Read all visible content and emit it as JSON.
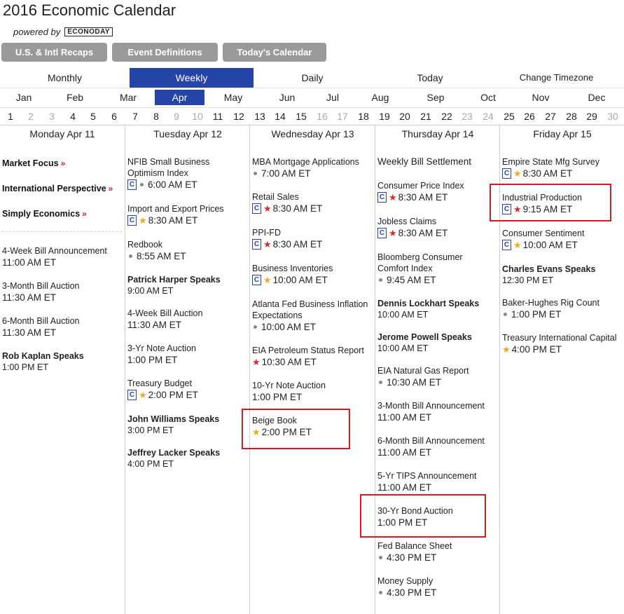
{
  "header": {
    "title": "2016 Economic Calendar",
    "powered_by": "powered by",
    "brand": "ECONODAY"
  },
  "buttons": [
    "U.S. & Intl Recaps",
    "Event Definitions",
    "Today's Calendar"
  ],
  "views": [
    "Monthly",
    "Weekly",
    "Daily",
    "Today",
    "Change Timezone"
  ],
  "active_view": "Weekly",
  "months": [
    "Jan",
    "Feb",
    "Mar",
    "Apr",
    "May",
    "Jun",
    "Jul",
    "Aug",
    "Sep",
    "Oct",
    "Nov",
    "Dec"
  ],
  "active_month": "Apr",
  "days": [
    "1",
    "2",
    "3",
    "4",
    "5",
    "6",
    "7",
    "8",
    "9",
    "10",
    "11",
    "12",
    "13",
    "14",
    "15",
    "16",
    "17",
    "18",
    "19",
    "20",
    "21",
    "22",
    "23",
    "24",
    "25",
    "26",
    "27",
    "28",
    "29",
    "30"
  ],
  "muted_days": [
    "2",
    "3",
    "9",
    "10",
    "16",
    "17",
    "23",
    "24",
    "30"
  ],
  "columns": {
    "mon": {
      "header": "Monday Apr 11",
      "links": [
        "Market Focus",
        "International Perspective",
        "Simply Economics"
      ],
      "events": [
        {
          "name": "4-Week Bill Announcement",
          "time": "11:00 AM ET",
          "bold": false
        },
        {
          "name": "3-Month Bill Auction",
          "time": "11:30 AM ET",
          "bold": false
        },
        {
          "name": "6-Month Bill Auction",
          "time": "11:30 AM ET",
          "bold": false
        },
        {
          "name": "Rob Kaplan Speaks",
          "time": "1:00 PM ET",
          "bold": true
        }
      ]
    },
    "tue": {
      "header": "Tuesday Apr 12",
      "events": [
        {
          "name": "NFIB Small Business Optimism Index",
          "time": "6:00 AM ET"
        },
        {
          "name": "Import and Export Prices",
          "time": "8:30 AM ET"
        },
        {
          "name": "Redbook",
          "time": "8:55 AM ET"
        },
        {
          "name": "Patrick Harper Speaks",
          "time": "9:00 AM ET"
        },
        {
          "name": "4-Week Bill Auction",
          "time": "11:30 AM ET"
        },
        {
          "name": "3-Yr Note Auction",
          "time": "1:00 PM ET"
        },
        {
          "name": "Treasury Budget",
          "time": "2:00 PM ET"
        },
        {
          "name": "John Williams Speaks",
          "time": "3:00 PM ET"
        },
        {
          "name": "Jeffrey Lacker Speaks",
          "time": "4:00 PM ET"
        }
      ]
    },
    "wed": {
      "header": "Wednesday Apr 13",
      "events": [
        {
          "name": "MBA Mortgage Applications",
          "time": "7:00 AM ET"
        },
        {
          "name": "Retail Sales",
          "time": "8:30 AM ET"
        },
        {
          "name": "PPI-FD",
          "time": "8:30 AM ET"
        },
        {
          "name": "Business Inventories",
          "time": "10:00 AM ET"
        },
        {
          "name": "Atlanta Fed Business Inflation Expectations",
          "time": "10:00 AM ET"
        },
        {
          "name": "EIA Petroleum Status Report",
          "time": "10:30 AM ET"
        },
        {
          "name": "10-Yr Note Auction",
          "time": "1:00 PM ET"
        },
        {
          "name": "Beige Book",
          "time": "2:00 PM ET"
        }
      ]
    },
    "thu": {
      "header": "Thursday Apr 14",
      "events": [
        {
          "name": "Weekly Bill Settlement",
          "time": ""
        },
        {
          "name": "Consumer Price Index",
          "time": "8:30 AM ET"
        },
        {
          "name": "Jobless Claims",
          "time": "8:30 AM ET"
        },
        {
          "name": "Bloomberg Consumer Comfort Index",
          "time": "9:45 AM ET"
        },
        {
          "name": "Dennis Lockhart Speaks",
          "time": "10:00 AM ET"
        },
        {
          "name": "Jerome Powell Speaks",
          "time": "10:00 AM ET"
        },
        {
          "name": "EIA Natural Gas Report",
          "time": "10:30 AM ET"
        },
        {
          "name": "3-Month Bill Announcement",
          "time": "11:00 AM ET"
        },
        {
          "name": "6-Month Bill Announcement",
          "time": "11:00 AM ET"
        },
        {
          "name": "5-Yr TIPS Announcement",
          "time": "11:00 AM ET"
        },
        {
          "name": "30-Yr Bond Auction",
          "time": "1:00 PM ET"
        },
        {
          "name": "Fed Balance Sheet",
          "time": "4:30 PM ET"
        },
        {
          "name": "Money Supply",
          "time": "4:30 PM ET"
        }
      ]
    },
    "fri": {
      "header": "Friday Apr 15",
      "events": [
        {
          "name": "Empire State Mfg Survey",
          "time": "8:30 AM ET"
        },
        {
          "name": "Industrial Production",
          "time": "9:15 AM ET"
        },
        {
          "name": "Consumer Sentiment",
          "time": "10:00 AM ET"
        },
        {
          "name": "Charles Evans Speaks",
          "time": "12:30 PM ET"
        },
        {
          "name": "Baker-Hughes Rig Count",
          "time": "1:00 PM ET"
        },
        {
          "name": "Treasury International Capital",
          "time": "4:00 PM ET"
        }
      ]
    }
  },
  "colors": {
    "accent": "#2444a8",
    "highlight": "#d71920",
    "star_red": "#d62a2a",
    "star_gold": "#f0a81c"
  },
  "icons": {
    "consensus_badge": "C",
    "star": "★",
    "bullet": "•",
    "more": "»"
  }
}
